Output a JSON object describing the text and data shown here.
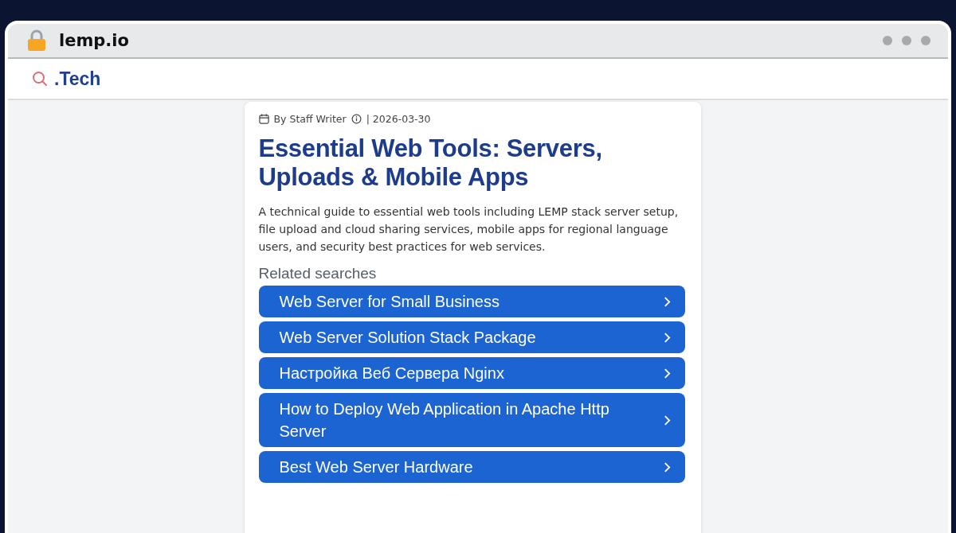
{
  "browser": {
    "address": "lemp.io"
  },
  "site": {
    "logo_text": ".Tech"
  },
  "article": {
    "author": "By Staff Writer",
    "date": "| 2026-03-30",
    "title": "Essential Web Tools: Servers, Uploads & Mobile Apps",
    "summary": "A technical guide to essential web tools including LEMP stack server setup, file upload and cloud sharing services, mobile apps for regional language users, and security best practices for web services."
  },
  "related": {
    "heading": "Related searches",
    "items": [
      {
        "label": "Web Server for Small Business"
      },
      {
        "label": "Web Server Solution Stack Package"
      },
      {
        "label": "Настройка Веб Сервера Nginx"
      },
      {
        "label": "How to Deploy Web Application in Apache Http Server"
      },
      {
        "label": "Best Web Server Hardware"
      }
    ]
  }
}
